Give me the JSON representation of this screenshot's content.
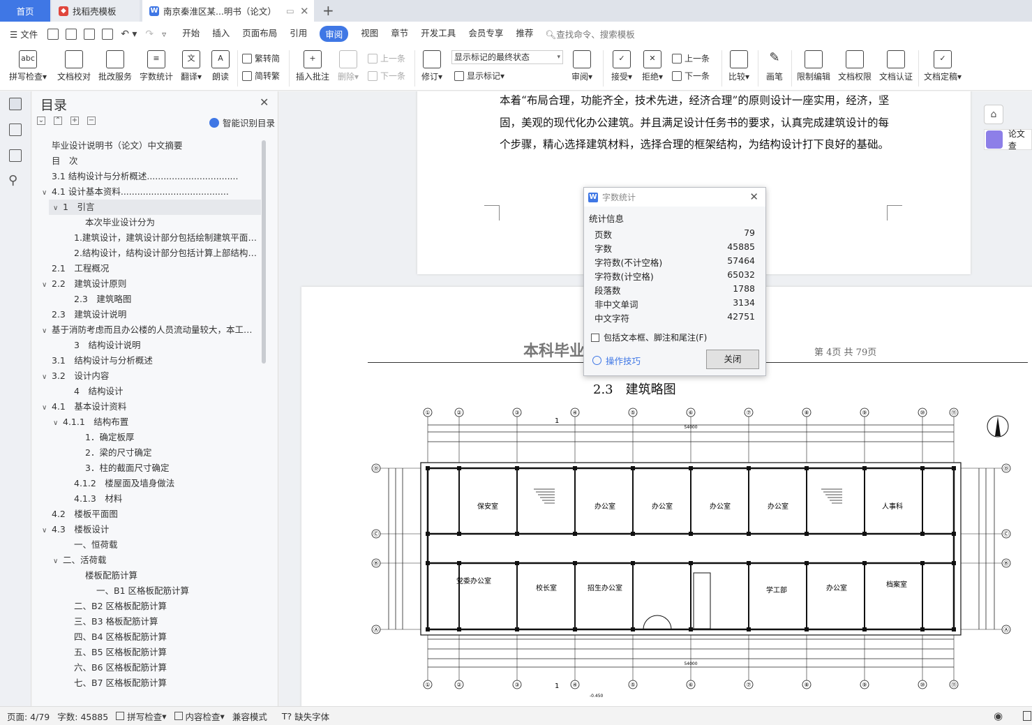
{
  "tabs": {
    "home": "首页",
    "template": "找稻壳模板",
    "doc": "南京秦淮区某...明书（论文）"
  },
  "menu": {
    "file": "文件",
    "items": [
      "开始",
      "插入",
      "页面布局",
      "引用",
      "审阅",
      "视图",
      "章节",
      "开发工具",
      "会员专享",
      "推荐"
    ],
    "active_index": 4,
    "search": "查找命令、搜索模板"
  },
  "ribbon": {
    "spell": "拼写检查",
    "proof": "文档校对",
    "batch": "批改服务",
    "count": "字数统计",
    "translate": "翻译",
    "read": "朗读",
    "trad": "繁转简",
    "simp": "简转繁",
    "comment": "插入批注",
    "delete": "删除",
    "prev": "上一条",
    "next": "下一条",
    "revise": "修订",
    "markup_state": "显示标记的最终状态",
    "show_markup": "显示标记",
    "review": "审阅",
    "accept": "接受",
    "reject": "拒绝",
    "prev2": "上一条",
    "next2": "下一条",
    "compare": "比较",
    "pen": "画笔",
    "restrict": "限制编辑",
    "perm": "文档权限",
    "cert": "文档认证",
    "final": "文档定稿"
  },
  "toc": {
    "title": "目录",
    "smart": "智能识别目录",
    "items": [
      {
        "t": "毕业设计说明书（论文）中文摘要",
        "lv": 0,
        "c": ""
      },
      {
        "t": "目　次",
        "lv": 0,
        "c": ""
      },
      {
        "t": "3.1  结构设计与分析概述.................................",
        "lv": 0,
        "c": ""
      },
      {
        "t": "4.1  设计基本资料.......................................",
        "lv": 0,
        "c": "v"
      },
      {
        "t": "1　引言",
        "lv": 1,
        "c": "v",
        "sel": true
      },
      {
        "t": "本次毕业设计分为",
        "lv": 3,
        "c": ""
      },
      {
        "t": "1.建筑设计，建筑设计部分包括绘制建筑平面图、…",
        "lv": 2,
        "c": ""
      },
      {
        "t": "2.结构设计，结构设计部分包括计算上部结构、楼…",
        "lv": 2,
        "c": ""
      },
      {
        "t": "2.1　工程概况",
        "lv": 0,
        "c": ""
      },
      {
        "t": "2.2　建筑设计原则",
        "lv": 0,
        "c": "v"
      },
      {
        "t": "2.3　建筑略图",
        "lv": 2,
        "c": ""
      },
      {
        "t": "2.3　建筑设计说明",
        "lv": 0,
        "c": ""
      },
      {
        "t": "基于消防考虑而且办公楼的人员流动量较大，本工程…",
        "lv": 0,
        "c": "v"
      },
      {
        "t": "3　结构设计说明",
        "lv": 2,
        "c": ""
      },
      {
        "t": "3.1　结构设计与分析概述",
        "lv": 0,
        "c": ""
      },
      {
        "t": "3.2　设计内容",
        "lv": 0,
        "c": "v"
      },
      {
        "t": "4　结构设计",
        "lv": 2,
        "c": ""
      },
      {
        "t": "4.1　基本设计资料",
        "lv": 0,
        "c": "v"
      },
      {
        "t": "4.1.1　结构布置",
        "lv": 1,
        "c": "v"
      },
      {
        "t": "1．确定板厚",
        "lv": 3,
        "c": ""
      },
      {
        "t": "2．梁的尺寸确定",
        "lv": 3,
        "c": ""
      },
      {
        "t": "3．柱的截面尺寸确定",
        "lv": 3,
        "c": ""
      },
      {
        "t": "4.1.2　楼屋面及墙身做法",
        "lv": 2,
        "c": ""
      },
      {
        "t": "4.1.3　材料",
        "lv": 2,
        "c": ""
      },
      {
        "t": "4.2　楼板平面图",
        "lv": 0,
        "c": ""
      },
      {
        "t": "4.3　楼板设计",
        "lv": 0,
        "c": "v"
      },
      {
        "t": "一、恒荷载",
        "lv": 2,
        "c": ""
      },
      {
        "t": "二、活荷载",
        "lv": 1,
        "c": "v"
      },
      {
        "t": "楼板配筋计算",
        "lv": 3,
        "c": ""
      },
      {
        "t": "一、B1 区格板配筋计算",
        "lv": 4,
        "c": ""
      },
      {
        "t": "二、B2 区格板配筋计算",
        "lv": 2,
        "c": ""
      },
      {
        "t": "三、B3 格板配筋计算",
        "lv": 2,
        "c": ""
      },
      {
        "t": "四、B4 区格板配筋计算",
        "lv": 2,
        "c": ""
      },
      {
        "t": "五、B5 区格板配筋计算",
        "lv": 2,
        "c": ""
      },
      {
        "t": "六、B6 区格板配筋计算",
        "lv": 2,
        "c": ""
      },
      {
        "t": "七、B7 区格板配筋计算",
        "lv": 2,
        "c": ""
      }
    ]
  },
  "doc": {
    "paragraph": "本着“布局合理，功能齐全，技术先进，经济合理”的原则设计一座实用，经济，坚固，美观的现代化办公建筑。并且满足设计任务书的要求，认真完成建筑设计的每个步骤，精心选择建筑材料，选择合理的框架结构，为结构设计打下良好的基础。",
    "header_left": "本科毕业",
    "header_right": "第 4页 共 79页",
    "section": "2.3　建筑略图",
    "side_label": "论文查"
  },
  "plan": {
    "axes_top": [
      "①",
      "②",
      "③",
      "④",
      "⑤",
      "⑥",
      "⑦",
      "⑧",
      "⑨",
      "⑩",
      "⑪"
    ],
    "axes_side": [
      "Ⓓ",
      "Ⓒ",
      "Ⓑ",
      "Ⓐ"
    ],
    "overall": "54000",
    "section_mark": "1",
    "rooms": [
      "保安室",
      "办公室",
      "办公室",
      "办公室",
      "办公室",
      "人事科",
      "党委办公室",
      "校长室",
      "招生办公室",
      "学工部",
      "办公室",
      "档案室"
    ],
    "elevation": "-0.450"
  },
  "dialog": {
    "title": "字数统计",
    "section": "统计信息",
    "rows": [
      {
        "k": "页数",
        "v": "79"
      },
      {
        "k": "字数",
        "v": "45885"
      },
      {
        "k": "字符数(不计空格)",
        "v": "57464"
      },
      {
        "k": "字符数(计空格)",
        "v": "65032"
      },
      {
        "k": "段落数",
        "v": "1788"
      },
      {
        "k": "非中文单词",
        "v": "3134"
      },
      {
        "k": "中文字符",
        "v": "42751"
      }
    ],
    "checkbox": "包括文本框、脚注和尾注(F)",
    "tip": "操作技巧",
    "close": "关闭"
  },
  "status": {
    "page": "页面: 4/79",
    "words": "字数: 45885",
    "spell": "拼写检查",
    "content": "内容检查",
    "compat": "兼容模式",
    "font": "缺失字体"
  },
  "colors": {
    "accent": "#3f77e5"
  }
}
